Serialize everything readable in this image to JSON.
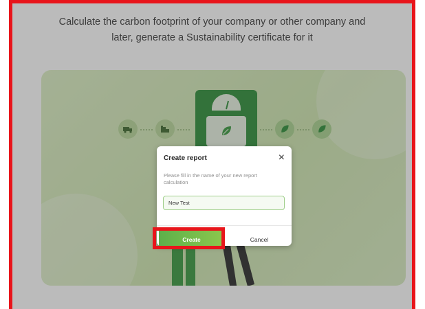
{
  "intro": {
    "line1": "Calculate the carbon footprint of your company or other company and",
    "line2": "later, generate a Sustainability certificate for it"
  },
  "hero": {
    "steps": [
      "truck-icon",
      "factory-icon",
      "leaf-icon",
      "leaf-icon",
      "leaf-icon"
    ],
    "scale_icon": "scale-icon"
  },
  "modal": {
    "title": "Create report",
    "close_label": "×",
    "description": "Please fill in the name of your new report calculation",
    "input_value": "New Test",
    "create_label": "Create",
    "cancel_label": "Cancel"
  },
  "colors": {
    "highlight": "#e8151b",
    "brand_green": "#2f8f3a",
    "button_green": "#6bb84c"
  }
}
